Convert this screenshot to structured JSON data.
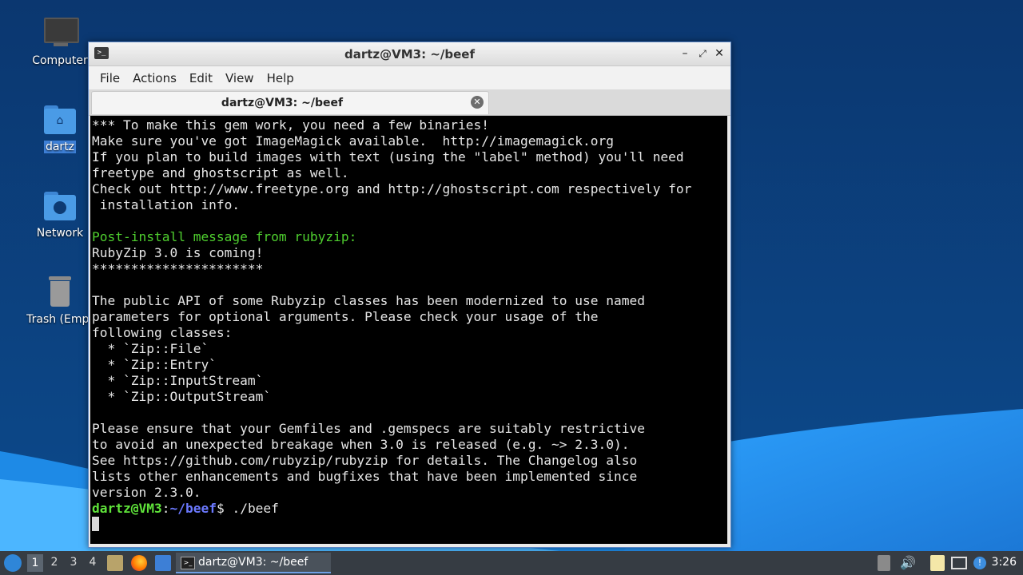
{
  "desktop": {
    "icons": [
      {
        "label": "Computer"
      },
      {
        "label": "dartz"
      },
      {
        "label": "Network"
      },
      {
        "label": "Trash (Empt"
      }
    ]
  },
  "window": {
    "title": "dartz@VM3: ~/beef",
    "menu": [
      "File",
      "Actions",
      "Edit",
      "View",
      "Help"
    ],
    "tab_title": "dartz@VM3: ~/beef",
    "terminal": {
      "lines_top": [
        "*** To make this gem work, you need a few binaries!",
        "Make sure you've got ImageMagick available.  http://imagemagick.org",
        "If you plan to build images with text (using the \"label\" method) you'll need",
        "freetype and ghostscript as well.",
        "Check out http://www.freetype.org and http://ghostscript.com respectively for",
        " installation info.",
        ""
      ],
      "post_install_header": "Post-install message from rubyzip:",
      "lines_bottom": [
        "RubyZip 3.0 is coming!",
        "**********************",
        "",
        "The public API of some Rubyzip classes has been modernized to use named",
        "parameters for optional arguments. Please check your usage of the",
        "following classes:",
        "  * `Zip::File`",
        "  * `Zip::Entry`",
        "  * `Zip::InputStream`",
        "  * `Zip::OutputStream`",
        "",
        "Please ensure that your Gemfiles and .gemspecs are suitably restrictive",
        "to avoid an unexpected breakage when 3.0 is released (e.g. ~> 2.3.0).",
        "See https://github.com/rubyzip/rubyzip for details. The Changelog also",
        "lists other enhancements and bugfixes that have been implemented since",
        "version 2.3.0."
      ],
      "prompt_user": "dartz@VM3",
      "prompt_sep": ":",
      "prompt_path": "~/beef",
      "prompt_symbol": "$",
      "command": " ./beef"
    }
  },
  "taskbar": {
    "workspaces": [
      "1",
      "2",
      "3",
      "4"
    ],
    "active_workspace": "1",
    "task_label": "dartz@VM3: ~/beef",
    "clock": "3:26"
  }
}
